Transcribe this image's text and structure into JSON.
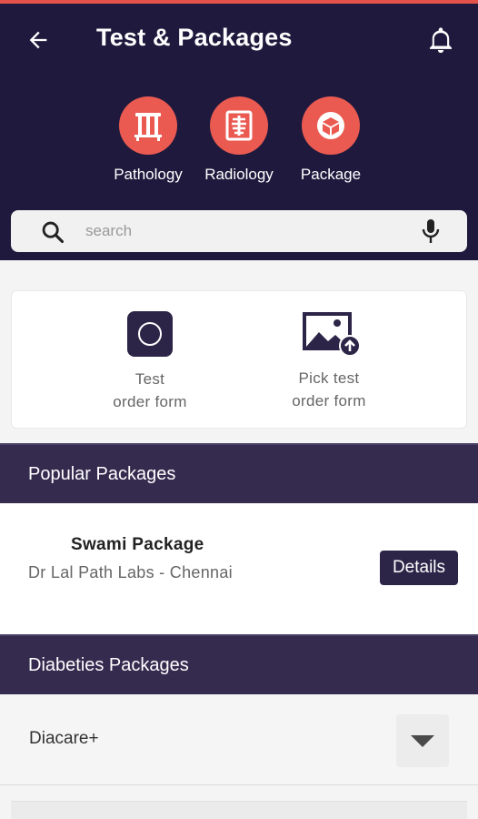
{
  "header": {
    "title": "Test & Packages",
    "back_icon": "arrow-left-icon",
    "bell_icon": "bell-icon"
  },
  "categories": [
    {
      "label": "Pathology",
      "icon": "test-tubes-icon"
    },
    {
      "label": "Radiology",
      "icon": "xray-icon"
    },
    {
      "label": "Package",
      "icon": "package-box-icon"
    }
  ],
  "search": {
    "placeholder": "search",
    "value": ""
  },
  "order_options": [
    {
      "line1": "Test",
      "line2": "order form",
      "icon": "order-form-icon"
    },
    {
      "line1": "Pick test",
      "line2": "order form",
      "icon": "image-upload-icon"
    }
  ],
  "popular": {
    "title": "Popular Packages",
    "package_name": "Swami Package",
    "lab": "Dr Lal Path Labs - Chennai",
    "details_label": "Details"
  },
  "diabetes": {
    "title": "Diabeties Packages",
    "selected": "Diacare+"
  },
  "colors": {
    "header_bg": "#1f1a3d",
    "accent": "#ea5a51",
    "section_bg": "#352b4f",
    "button_bg": "#2c2547"
  }
}
